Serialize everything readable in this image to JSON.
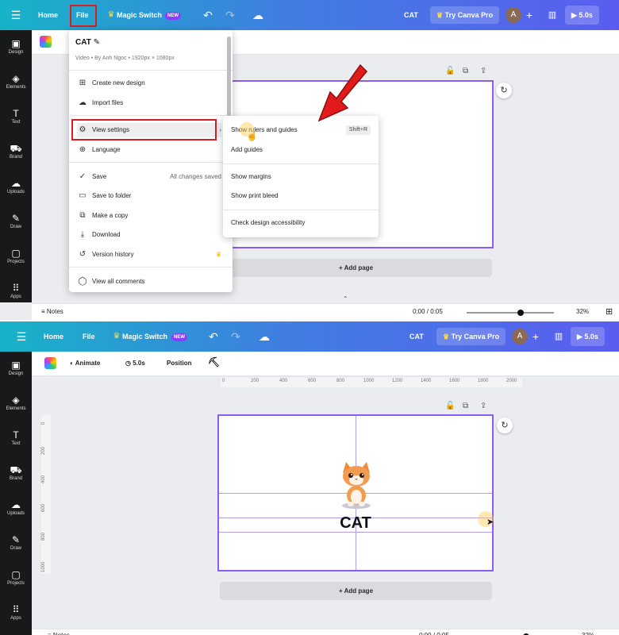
{
  "topbar": {
    "home_label": "Home",
    "file_label": "File",
    "magic_label": "Magic Switch",
    "new_badge": "NEW",
    "title": "CAT",
    "try_label": "Try Canva Pro",
    "avatar_letter": "A",
    "play_label": "5.0s"
  },
  "sidebar": {
    "items": [
      {
        "label": "Design",
        "icon": "▣"
      },
      {
        "label": "Elements",
        "icon": "◈"
      },
      {
        "label": "Text",
        "icon": "T"
      },
      {
        "label": "Brand",
        "icon": "⛟"
      },
      {
        "label": "Uploads",
        "icon": "☁"
      },
      {
        "label": "Draw",
        "icon": "✎"
      },
      {
        "label": "Projects",
        "icon": "▢"
      },
      {
        "label": "Apps",
        "icon": "⠿"
      }
    ]
  },
  "file_menu": {
    "design_name": "CAT",
    "design_meta": "Video • By Anh Ngoc • 1920px × 1080px",
    "items": {
      "create": "Create new design",
      "import": "Import files",
      "view_settings": "View settings",
      "language": "Language",
      "save": "Save",
      "save_status": "All changes saved",
      "save_folder": "Save to folder",
      "make_copy": "Make a copy",
      "download": "Download",
      "version_history": "Version history",
      "view_comments": "View all comments"
    }
  },
  "view_submenu": {
    "rulers": "Show rulers and guides",
    "rulers_shortcut": "Shift+R",
    "add_guides": "Add guides",
    "margins": "Show margins",
    "print_bleed": "Show print bleed",
    "accessibility": "Check design accessibility"
  },
  "canvas": {
    "add_page": "+ Add page",
    "cat_text": "CAT"
  },
  "bottombar": {
    "notes": "Notes",
    "time": "0:00 / 0:05",
    "zoom": "32%",
    "zoom_fraction": 0.32
  },
  "toolbar2": {
    "animate": "Animate",
    "duration": "5.0s",
    "position": "Position"
  },
  "ruler": {
    "h_ticks": [
      "0",
      "200",
      "400",
      "600",
      "800",
      "1000",
      "1200",
      "1400",
      "1600",
      "1800",
      "2000"
    ],
    "v_ticks": [
      "0",
      "200",
      "400",
      "600",
      "800",
      "1000"
    ]
  },
  "colors": {
    "accent": "#8b3dff",
    "highlight": "#d81e1e",
    "sidebar": "#18191b"
  }
}
